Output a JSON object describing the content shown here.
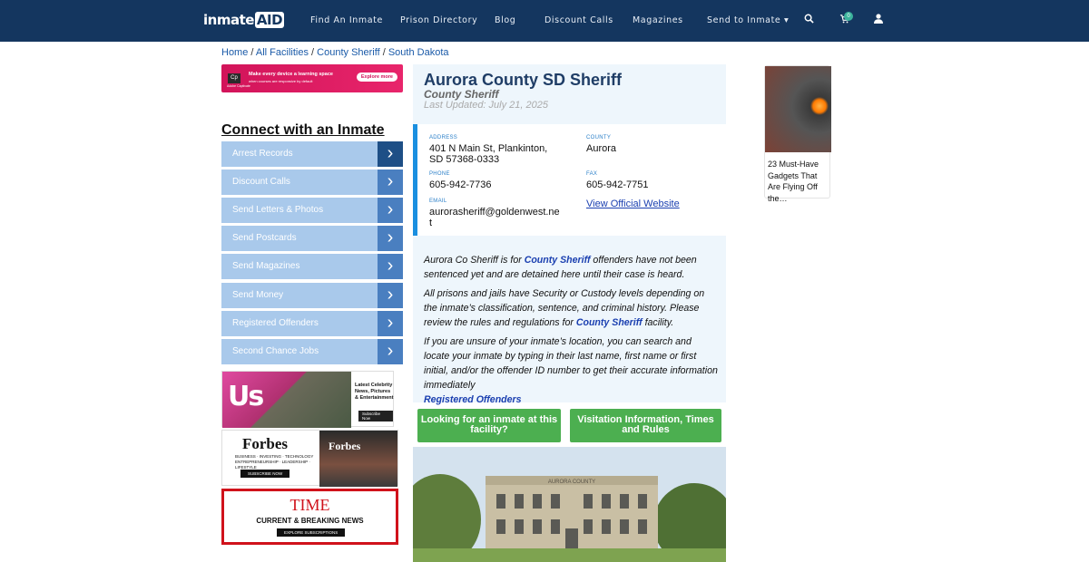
{
  "nav": {
    "logo_a": "inmate",
    "logo_b": "AID",
    "links": [
      "Find An Inmate",
      "Prison Directory",
      "Blog",
      "Discount Calls",
      "Magazines",
      "Send to Inmate"
    ],
    "cart_count": "0"
  },
  "breadcrumb": {
    "home": "Home",
    "all": "All Facilities",
    "type": "County Sheriff",
    "state": "South Dakota"
  },
  "ad_top": {
    "brand": "Cp",
    "tagline": "Make every device a learning space",
    "sub": "when courses are responsive by default",
    "button": "Explore more",
    "maker": "Adobe Captivate"
  },
  "sidebar": {
    "heading": "Connect with an Inmate",
    "items": [
      "Arrest Records",
      "Discount Calls",
      "Send Letters & Photos",
      "Send Postcards",
      "Send Magazines",
      "Send Money",
      "Registered Offenders",
      "Second Chance Jobs"
    ]
  },
  "ads": {
    "us_logo": "Us",
    "us_text": "Latest Celebrity News, Pictures & Entertainment",
    "us_button": "Subscribe Now",
    "forbes_logo": "Forbes",
    "forbes_desc": "BUSINESS · INVESTING · TECHNOLOGY ENTREPRENEURSHIP · LEADERSHIP · LIFESTYLE",
    "forbes_button": "SUBSCRIBE NOW",
    "forbes_cover": "Forbes",
    "time_logo": "TIME",
    "time_text": "CURRENT & BREAKING NEWS",
    "time_button": "EXPLORE SUBSCRIPTIONS"
  },
  "facility": {
    "name": "Aurora County SD Sheriff",
    "type": "County Sheriff",
    "updated": "Last Updated: July 21, 2025",
    "address_label": "ADDRESS",
    "address_line1": "401 N Main St, Plankinton,",
    "address_line2": "SD 57368-0333",
    "county_label": "COUNTY",
    "county": "Aurora",
    "phone_label": "PHONE",
    "phone": "605-942-7736",
    "fax_label": "FAX",
    "fax": "605-942-7751",
    "email_label": "EMAIL",
    "email_line1": "aurorasheriff@goldenwest.ne",
    "email_line2": "t",
    "website": "View Official Website"
  },
  "content": {
    "p1_a": "Aurora Co Sheriff is for ",
    "p1_link": "County Sheriff",
    "p1_b": " offenders have not been sentenced yet and are detained here until their case is heard.",
    "p2_a": "All prisons and jails have Security or Custody levels depending on the inmate’s classification, sentence, and criminal history. Please review the rules and regulations for ",
    "p2_link": "County Sheriff",
    "p2_b": " facility.",
    "p3": "If you are unsure of your inmate’s location, you can search and locate your inmate by typing in their last name, first name or first initial, and/or the offender ID number to get their accurate information immediately",
    "p3_link": "Registered Offenders"
  },
  "buttons": {
    "looking": "Looking for an inmate at this facility?",
    "visitation": "Visitation Information, Times and Rules"
  },
  "photo_sign": "AURORA   COUNTY",
  "right_ad": {
    "caption": "23 Must-Have Gadgets That Are Flying Off the…"
  }
}
